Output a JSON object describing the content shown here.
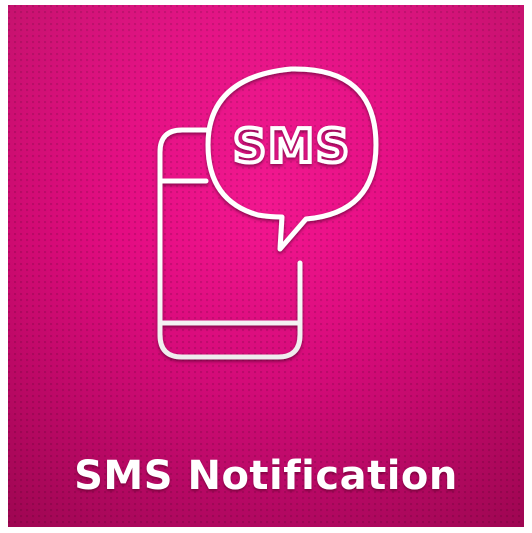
{
  "icon": {
    "name": "sms-phone-icon",
    "bubble_text": "SMS"
  },
  "caption": "SMS Notification",
  "colors": {
    "background": "#e40c82",
    "foreground": "#ffffff"
  }
}
